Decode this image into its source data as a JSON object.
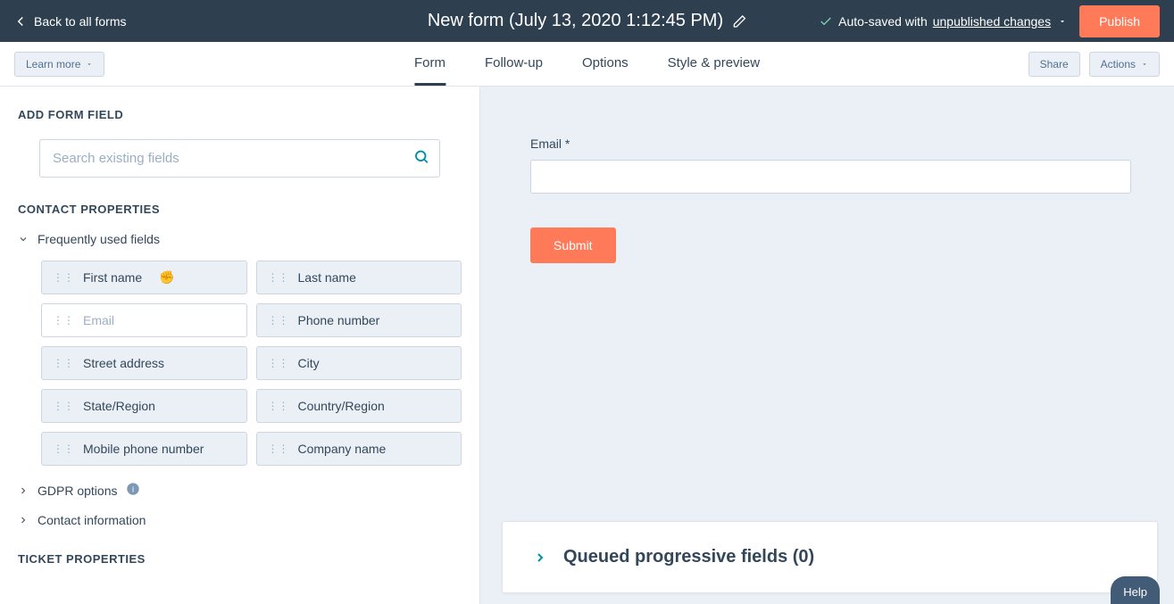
{
  "header": {
    "back_label": "Back to all forms",
    "title": "New form (July 13, 2020 1:12:45 PM)",
    "autosave_prefix": "Auto-saved with ",
    "autosave_link": "unpublished changes",
    "publish_label": "Publish"
  },
  "toolbar": {
    "learn_label": "Learn more",
    "tabs": [
      "Form",
      "Follow-up",
      "Options",
      "Style & preview"
    ],
    "active_tab": "Form",
    "share_label": "Share",
    "actions_label": "Actions"
  },
  "left": {
    "add_field_header": "ADD FORM FIELD",
    "search_placeholder": "Search existing fields",
    "contact_props_header": "CONTACT PROPERTIES",
    "freq_label": "Frequently used fields",
    "fields": [
      {
        "label": "First name",
        "disabled": false,
        "hovered": true
      },
      {
        "label": "Last name",
        "disabled": false
      },
      {
        "label": "Email",
        "disabled": true
      },
      {
        "label": "Phone number",
        "disabled": false
      },
      {
        "label": "Street address",
        "disabled": false
      },
      {
        "label": "City",
        "disabled": false
      },
      {
        "label": "State/Region",
        "disabled": false
      },
      {
        "label": "Country/Region",
        "disabled": false
      },
      {
        "label": "Mobile phone number",
        "disabled": false
      },
      {
        "label": "Company name",
        "disabled": false
      }
    ],
    "gdpr_label": "GDPR options",
    "contact_info_label": "Contact information",
    "ticket_props_header": "TICKET PROPERTIES"
  },
  "preview": {
    "email_label": "Email *",
    "submit_label": "Submit",
    "queued_label": "Queued progressive fields (0)"
  },
  "help_label": "Help"
}
